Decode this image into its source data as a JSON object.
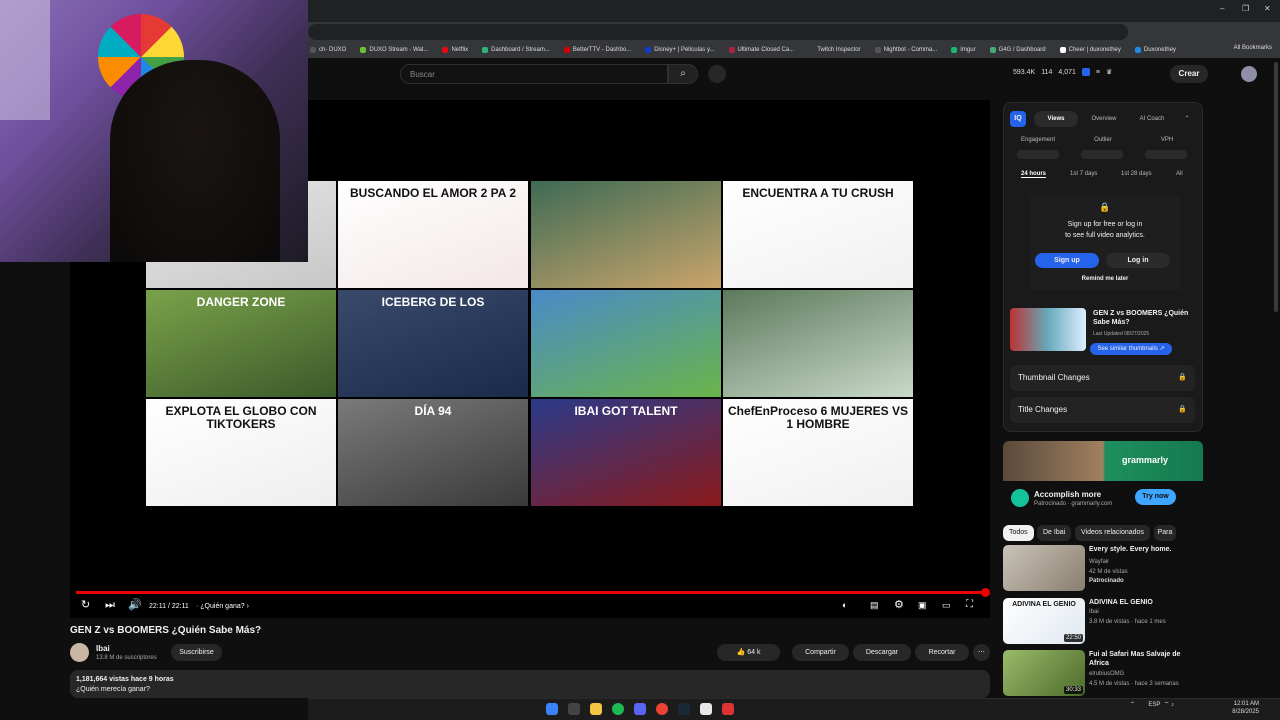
{
  "browser": {
    "bookmarks": [
      "ch- DUXO",
      "DUXO Stream - Wat...",
      "Netflix",
      "Dashboard / Stream...",
      "BetterTTV - Dashbo...",
      "Disney+ | Películas y...",
      "Ultimate Closed Ca...",
      "Twitch Inspector",
      "Nightbot - Comma...",
      "Imgur",
      "G4G / Dashboard",
      "Cheer | duxonethey",
      "Duxonethey"
    ],
    "all_bookmarks": "All Bookmarks",
    "window_controls": [
      "–",
      "❐",
      "✕"
    ]
  },
  "header": {
    "search_placeholder": "Buscar",
    "search_icon": "search-icon",
    "stats": [
      "593.4K",
      "114",
      "4,071"
    ],
    "create_label": "Crear"
  },
  "player": {
    "thumbnails": [
      {
        "title": "",
        "colors": [
          "#e8e8e8",
          "#c7c7c7"
        ]
      },
      {
        "title": "BUSCANDO EL AMOR 2 PA 2",
        "colors": [
          "#ffffff",
          "#f3e7e7"
        ]
      },
      {
        "title": "",
        "colors": [
          "#3e6b54",
          "#c9a46b"
        ]
      },
      {
        "title": "ENCUENTRA A TU CRUSH",
        "colors": [
          "#ffffff",
          "#f0f0f0"
        ]
      },
      {
        "title": "DANGER ZONE",
        "colors": [
          "#7aa24a",
          "#3b5a2a"
        ]
      },
      {
        "title": "ICEBERG DE LOS",
        "colors": [
          "#3a4a6a",
          "#1a2a4a"
        ]
      },
      {
        "title": "",
        "colors": [
          "#4a8ac9",
          "#6ab44a"
        ]
      },
      {
        "title": "",
        "colors": [
          "#5c7a5c",
          "#c9d9c9"
        ]
      },
      {
        "title": "EXPLOTA EL GLOBO CON TIKTOKERS",
        "colors": [
          "#ffffff",
          "#eeeeee"
        ]
      },
      {
        "title": "DÍA 94",
        "colors": [
          "#7a7a7a",
          "#3a3a3a"
        ]
      },
      {
        "title": "IBAI GOT TALENT",
        "colors": [
          "#2a3a8a",
          "#8a1a1a"
        ]
      },
      {
        "title": "ChefEnProceso 6 MUJERES VS 1 HOMBRE",
        "colors": [
          "#ffffff",
          "#f0f0f0"
        ]
      }
    ],
    "time": "22:11 / 22:11",
    "chapter": "¿Quién gana?",
    "progress": 1.0
  },
  "video": {
    "title": "GEN Z vs BOOMERS ¿Quién Sabe Más?",
    "channel": "Ibai",
    "subscribers": "13.8 M de suscriptores",
    "subscribe_label": "Suscribirse",
    "likes": "64 k",
    "share_label": "Compartir",
    "download_label": "Descargar",
    "clip_label": "Recortar",
    "views_line": "1,181,664 vistas  hace 9 horas",
    "desc_line": "¿Quién merecía ganar?"
  },
  "vidiq": {
    "tabs": [
      "Views",
      "Overview",
      "AI Coach"
    ],
    "metrics": [
      "Engagement",
      "Outlier",
      "VPH"
    ],
    "ranges": [
      "24 hours",
      "1st 7 days",
      "1st 28 days",
      "All"
    ],
    "lock_line1": "Sign up for free or log in",
    "lock_line2": "to see full video analytics.",
    "signup_label": "Sign up",
    "login_label": "Log in",
    "remind_label": "Remind me later",
    "video_title": "GEN Z vs BOOMERS ¿Quién Sabe Más?",
    "last_updated": "Last Updated 08/27/2025",
    "similar_label": "See similar thumbnails ↗",
    "thumb_changes": "Thumbnail Changes",
    "title_changes": "Title Changes"
  },
  "ad": {
    "brand": "grammarly",
    "title": "Accomplish more",
    "sponsor": "Patrocinado · grammarly.com",
    "cta": "Try now"
  },
  "chips": [
    "Todos",
    "De Ibai",
    "Videos relacionados",
    "Para"
  ],
  "recs": [
    {
      "title": "Every style. Every home.",
      "channel": "Wayfair",
      "meta": "42 M de vistas",
      "extra": "Patrocinado",
      "duration": ""
    },
    {
      "title": "ADIVINA EL GENIO",
      "channel": "Ibai",
      "meta": "3.8 M de vistas · hace 1 mes",
      "extra": "",
      "duration": "22:50"
    },
    {
      "title": "Fui al Safari Mas Salvaje de Africa",
      "channel": "elrubiusOMG",
      "meta": "4.5 M de vistas · hace 3 semanas",
      "extra": "",
      "duration": "30:33"
    }
  ],
  "taskbar": {
    "lang": "ESP",
    "time": "12:01 AM",
    "date": "8/28/2025"
  }
}
